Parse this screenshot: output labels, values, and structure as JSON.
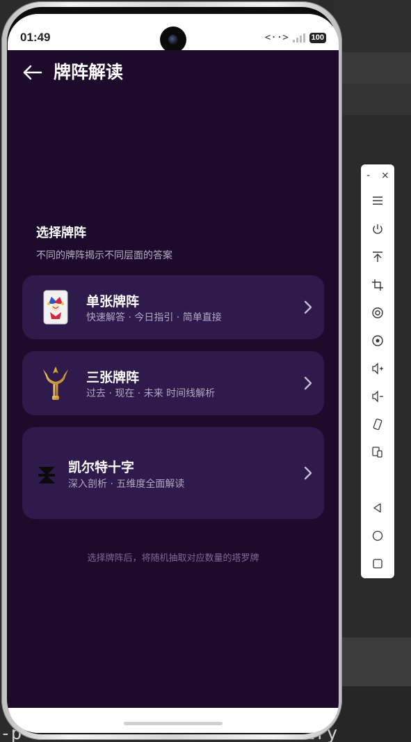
{
  "status_bar": {
    "time": "01:49",
    "network": "<··>",
    "battery": "100"
  },
  "header": {
    "title": "牌阵解读"
  },
  "section": {
    "title": "选择牌阵",
    "subtitle": "不同的牌阵揭示不同层面的答案"
  },
  "spreads": [
    {
      "title": "单张牌阵",
      "desc": "快速解答 · 今日指引 · 简单直接",
      "icon": "joker-card-icon"
    },
    {
      "title": "三张牌阵",
      "desc": "过去 · 现在 · 未来 时间线解析",
      "icon": "trident-icon"
    },
    {
      "title": "凯尔特十字",
      "desc": "深入剖析 · 五维度全面解读",
      "icon": "celtic-cross-icon"
    }
  ],
  "footer_hint": "选择牌阵后，将随机抽取对应数量的塔罗牌",
  "terminal_text": "-p ... ... ... ... ... -m entry",
  "colors": {
    "app_background": "#1d0b2c",
    "card_background": "#2e1a4b",
    "title_text": "#ffffff",
    "muted_text": "#b3a6c4"
  },
  "toolbar": {
    "minimize": "-",
    "close": "×",
    "buttons": [
      "menu-icon",
      "power-icon",
      "pin-top-icon",
      "crop-icon",
      "screenshot-icon",
      "screen-record-icon",
      "volume-up-icon",
      "volume-down-icon",
      "rotate-icon",
      "multi-device-icon",
      "back-icon",
      "home-icon",
      "recents-icon"
    ]
  }
}
